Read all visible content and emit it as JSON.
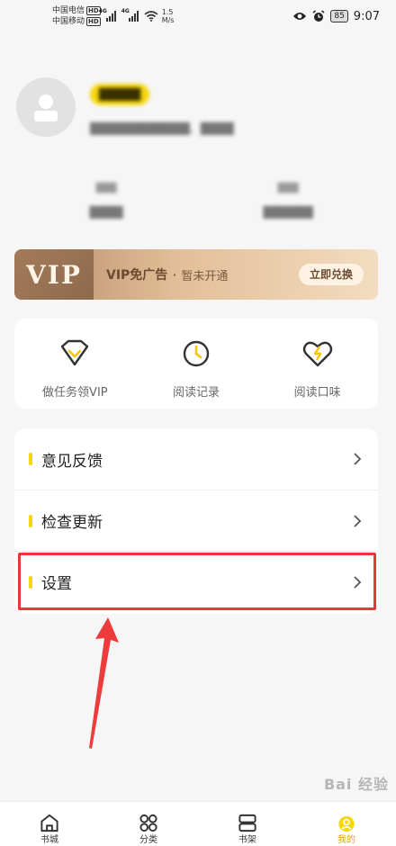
{
  "status_bar": {
    "carrier_1": "中国电信",
    "carrier_2": "中国移动",
    "hd": "HD",
    "network_1": "4G",
    "network_2": "4G",
    "speed_value": "1.5",
    "speed_unit": "M/s",
    "battery": "85",
    "time": "9:07",
    "icons": [
      "eye-icon",
      "alarm-icon",
      "wifi-icon",
      "signal-icon",
      "battery-icon"
    ]
  },
  "profile": {
    "nickname": "█████",
    "bio": "████████████、████",
    "stats": [
      {
        "number": "███",
        "label": "████"
      },
      {
        "number": "███",
        "label": "██████"
      }
    ]
  },
  "vip": {
    "logo": "VIP",
    "title": "VIP免广告",
    "separator": "·",
    "status": "暂未开通",
    "button": "立即兑换"
  },
  "quick_actions": [
    {
      "label": "做任务领VIP",
      "icon": "diamond-icon"
    },
    {
      "label": "阅读记录",
      "icon": "clock-icon"
    },
    {
      "label": "阅读口味",
      "icon": "heart-icon"
    }
  ],
  "menu": [
    {
      "label": "意见反馈"
    },
    {
      "label": "检查更新"
    },
    {
      "label": "设置"
    }
  ],
  "bottom_nav": [
    {
      "label": "书城",
      "icon": "home-icon"
    },
    {
      "label": "分类",
      "icon": "category-icon"
    },
    {
      "label": "书架",
      "icon": "bookshelf-icon"
    },
    {
      "label": "我的",
      "icon": "profile-icon"
    }
  ],
  "watermark": "Bai 经验",
  "colors": {
    "accent": "#f6d70c",
    "highlight": "#e8393a",
    "vip_gold": "#c9a27a",
    "active_tab": "#e3a300"
  }
}
